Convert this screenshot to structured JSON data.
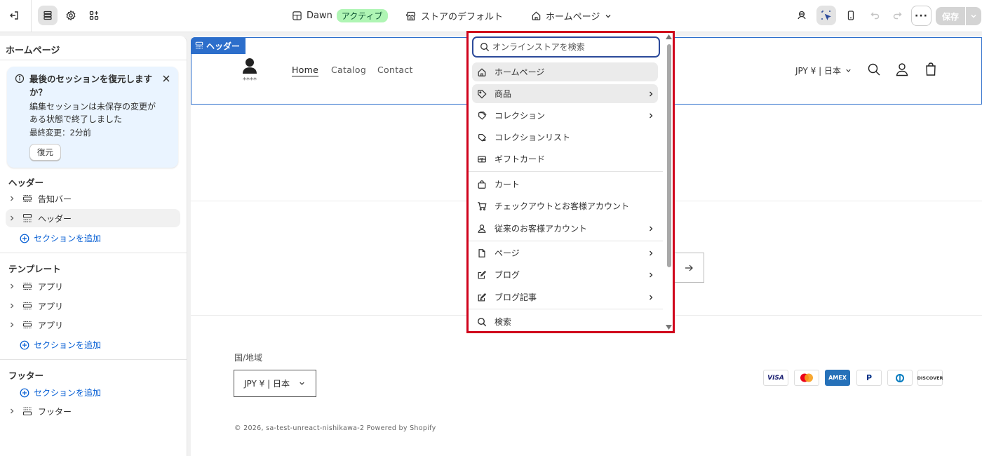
{
  "topbar": {
    "theme_name": "Dawn",
    "theme_status": "アクティブ",
    "store_default": "ストアのデフォルト",
    "page_selector": "ホームページ",
    "save_label": "保存",
    "more_label": "···"
  },
  "sidebar": {
    "title": "ホームページ",
    "restore": {
      "title": "最後のセッションを復元しますか？",
      "text": "編集セッションは未保存の変更がある状態で終了しました",
      "meta": "最終変更：2分前",
      "button": "復元"
    },
    "header_section": {
      "heading": "ヘッダー",
      "items": [
        "告知バー",
        "ヘッダー"
      ],
      "add": "セクションを追加"
    },
    "template_section": {
      "heading": "テンプレート",
      "items": [
        "アプリ",
        "アプリ",
        "アプリ"
      ],
      "add": "セクションを追加"
    },
    "footer_section": {
      "heading": "フッター",
      "add": "セクションを追加",
      "items": [
        "フッター"
      ]
    }
  },
  "preview": {
    "header_tag": "ヘッダー",
    "logo_text": "****",
    "nav": [
      "Home",
      "Catalog",
      "Contact"
    ],
    "currency": "JPY ¥ | 日本",
    "country_label": "国/地域",
    "country_value": "JPY ¥ | 日本",
    "copyright": "© 2026, sa-test-unreact-nishikawa-2 Powered by Shopify",
    "payments": [
      "VISA",
      "Mastercard",
      "AMEX",
      "PayPal",
      "Diners",
      "DISCOVER"
    ]
  },
  "dropdown": {
    "search_placeholder": "オンラインストアを検索",
    "items": [
      {
        "label": "ホームページ",
        "icon": "home-icon"
      },
      {
        "label": "商品",
        "icon": "tag-icon"
      },
      {
        "label": "コレクション",
        "icon": "collection-icon"
      },
      {
        "label": "コレクションリスト",
        "icon": "collection-list-icon"
      },
      {
        "label": "ギフトカード",
        "icon": "gift-card-icon"
      },
      {
        "label": "カート",
        "icon": "cart-bag-icon"
      },
      {
        "label": "チェックアウトとお客様アカウント",
        "icon": "cart-icon"
      },
      {
        "label": "従来のお客様アカウント",
        "icon": "person-icon"
      },
      {
        "label": "ページ",
        "icon": "page-icon"
      },
      {
        "label": "ブログ",
        "icon": "blog-icon"
      },
      {
        "label": "ブログ記事",
        "icon": "blog-post-icon"
      },
      {
        "label": "検索",
        "icon": "search-icon"
      }
    ]
  },
  "colors": {
    "accent_blue": "#2c6ecb",
    "highlight_red": "#d0021b",
    "active_badge": "#aff5b4"
  }
}
